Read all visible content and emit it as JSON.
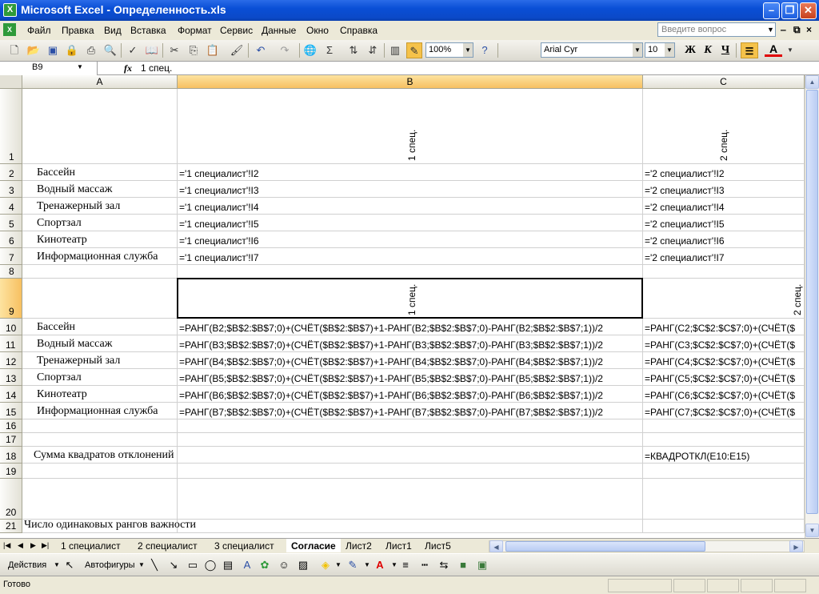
{
  "window": {
    "title": "Microsoft Excel - Определенность.xls",
    "icon": "excel-icon"
  },
  "menu": [
    "Файл",
    "Правка",
    "Вид",
    "Вставка",
    "Формат",
    "Сервис",
    "Данные",
    "Окно",
    "Справка"
  ],
  "help_placeholder": "Введите вопрос",
  "toolbar": {
    "zoom": "100%",
    "font": "Arial Cyr",
    "size": "10",
    "bold": "Ж",
    "italic": "К",
    "underline": "Ч",
    "font_color_label": "A"
  },
  "formula": {
    "cell": "B9",
    "fx": "fx",
    "value": "1 спец."
  },
  "columns": [
    "A",
    "B",
    "C"
  ],
  "rows": [
    "1",
    "2",
    "3",
    "4",
    "5",
    "6",
    "7",
    "8",
    "9",
    "10",
    "11",
    "12",
    "13",
    "14",
    "15",
    "16",
    "17",
    "18",
    "19",
    "20",
    "21"
  ],
  "header1": {
    "b": "1 спец.",
    "c": "2 спец."
  },
  "header9": {
    "b": "1 спец.",
    "c": "2 спец."
  },
  "labels": [
    "Бассейн",
    "Водный массаж",
    "Тренажерный зал",
    "Спортзал",
    "Кинотеатр",
    "Информационная служба"
  ],
  "refs_b": [
    "='1 специалист'!I2",
    "='1 специалист'!I3",
    "='1 специалист'!I4",
    "='1 специалист'!I5",
    "='1 специалист'!I6",
    "='1 специалист'!I7"
  ],
  "refs_c": [
    "='2 специалист'!I2",
    "='2 специалист'!I3",
    "='2 специалист'!I4",
    "='2 специалист'!I5",
    "='2 специалист'!I6",
    "='2 специалист'!I7"
  ],
  "ranks_b": [
    "=РАНГ(B2;$B$2:$B$7;0)+(СЧЁТ($B$2:$B$7)+1-РАНГ(B2;$B$2:$B$7;0)-РАНГ(B2;$B$2:$B$7;1))/2",
    "=РАНГ(B3;$B$2:$B$7;0)+(СЧЁТ($B$2:$B$7)+1-РАНГ(B3;$B$2:$B$7;0)-РАНГ(B3;$B$2:$B$7;1))/2",
    "=РАНГ(B4;$B$2:$B$7;0)+(СЧЁТ($B$2:$B$7)+1-РАНГ(B4;$B$2:$B$7;0)-РАНГ(B4;$B$2:$B$7;1))/2",
    "=РАНГ(B5;$B$2:$B$7;0)+(СЧЁТ($B$2:$B$7)+1-РАНГ(B5;$B$2:$B$7;0)-РАНГ(B5;$B$2:$B$7;1))/2",
    "=РАНГ(B6;$B$2:$B$7;0)+(СЧЁТ($B$2:$B$7)+1-РАНГ(B6;$B$2:$B$7;0)-РАНГ(B6;$B$2:$B$7;1))/2",
    "=РАНГ(B7;$B$2:$B$7;0)+(СЧЁТ($B$2:$B$7)+1-РАНГ(B7;$B$2:$B$7;0)-РАНГ(B7;$B$2:$B$7;1))/2"
  ],
  "ranks_c": [
    "=РАНГ(C2;$C$2:$C$7;0)+(СЧЁТ($",
    "=РАНГ(C3;$C$2:$C$7;0)+(СЧЁТ($",
    "=РАНГ(C4;$C$2:$C$7;0)+(СЧЁТ($",
    "=РАНГ(C5;$C$2:$C$7;0)+(СЧЁТ($",
    "=РАНГ(C6;$C$2:$C$7;0)+(СЧЁТ($",
    "=РАНГ(C7;$C$2:$C$7;0)+(СЧЁТ($"
  ],
  "row18": {
    "a": "Сумма квадратов отклонений",
    "c": "=КВАДРОТКЛ(E10:E15)"
  },
  "row21": {
    "a": "Число одинаковых рангов важности"
  },
  "sheets": [
    "1 специалист",
    "2 специалист",
    "3 специалист",
    "Согласие",
    "Лист2",
    "Лист1",
    "Лист5"
  ],
  "active_sheet": "Согласие",
  "drawing": {
    "actions": "Действия",
    "autoshapes": "Автофигуры"
  },
  "status": "Готово"
}
